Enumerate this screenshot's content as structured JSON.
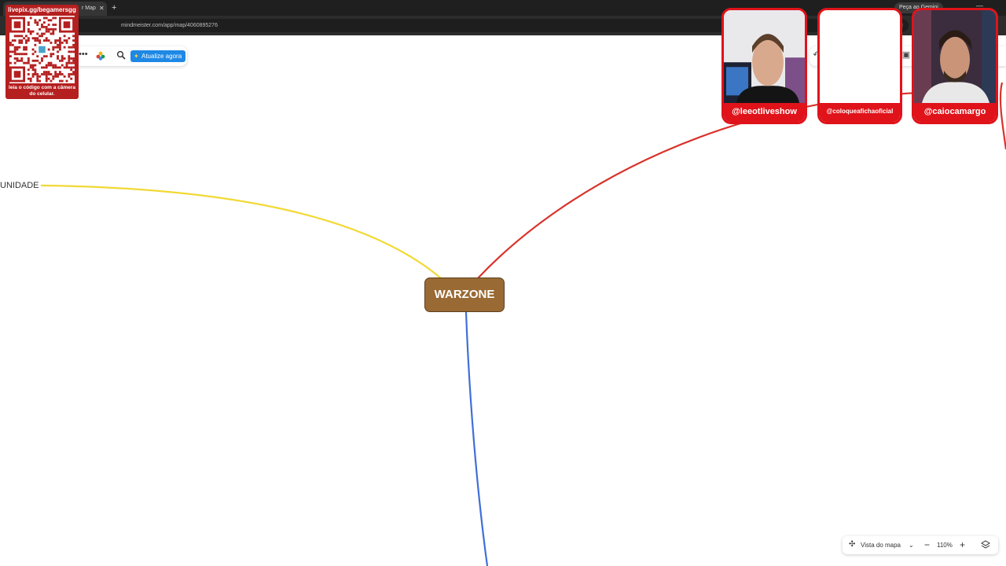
{
  "browser": {
    "tab_title": "r Map",
    "tab_close": "✕",
    "new_tab": "+",
    "gemini_button": "Peça ao Gemini",
    "url": "mindmeister.com/app/map/4060895276"
  },
  "toolbar": {
    "more": "•••",
    "upgrade_label": "Atualize agora"
  },
  "mindmap": {
    "root_label": "WARZONE",
    "branch_left_label": "UNIDADE",
    "branch_colors": {
      "yellow": "#f2d935",
      "red": "#d9322a",
      "blue": "#3f6fd8"
    },
    "root_color": "#9a6a34"
  },
  "bottom_controls": {
    "map_view_label": "Vista do mapa",
    "zoom_level": "110%",
    "zoom_out": "−",
    "zoom_in": "+"
  },
  "overlay": {
    "qr_link": "livepix.gg/begamersgg",
    "qr_caption": "leia o código com a câmera do celular."
  },
  "webcams": [
    {
      "name": "@leeotliveshow"
    },
    {
      "name": "@coloqueafichaoficial"
    },
    {
      "name": "@caiocamargo"
    }
  ]
}
